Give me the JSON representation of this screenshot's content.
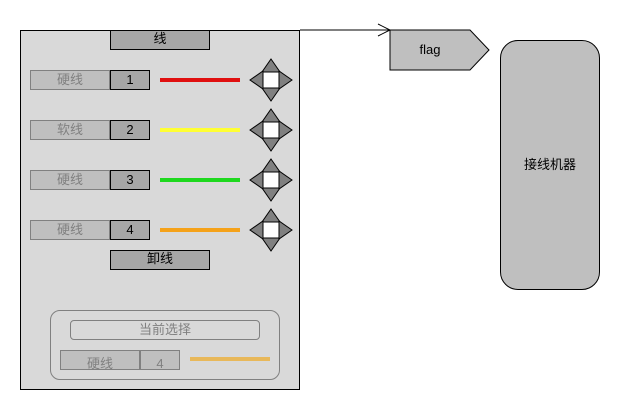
{
  "panel": {
    "header_label": "线",
    "unload_label": "卸线",
    "rows": [
      {
        "label": "硬线",
        "number": "1",
        "line_color": "#e01010",
        "line_name": "red-line"
      },
      {
        "label": "软线",
        "number": "2",
        "line_color": "#ffff33",
        "line_name": "yellow-line"
      },
      {
        "label": "硬线",
        "number": "3",
        "line_color": "#1ed81e",
        "line_name": "green-line"
      },
      {
        "label": "硬线",
        "number": "4",
        "line_color": "#f5a21a",
        "line_name": "orange-line"
      }
    ]
  },
  "current": {
    "title": "当前选择",
    "label": "硬线",
    "number": "4",
    "line_color": "#e8b85a"
  },
  "flag": {
    "label": "flag"
  },
  "machine": {
    "label": "接线机器"
  },
  "colors": {
    "panel_bg": "#d9d9d9",
    "button_bg": "#a6a6a6",
    "label_bg": "#bfbfbf",
    "dpad_bg": "#808080"
  },
  "icons": {
    "dpad": "four-way-arrow-icon"
  }
}
